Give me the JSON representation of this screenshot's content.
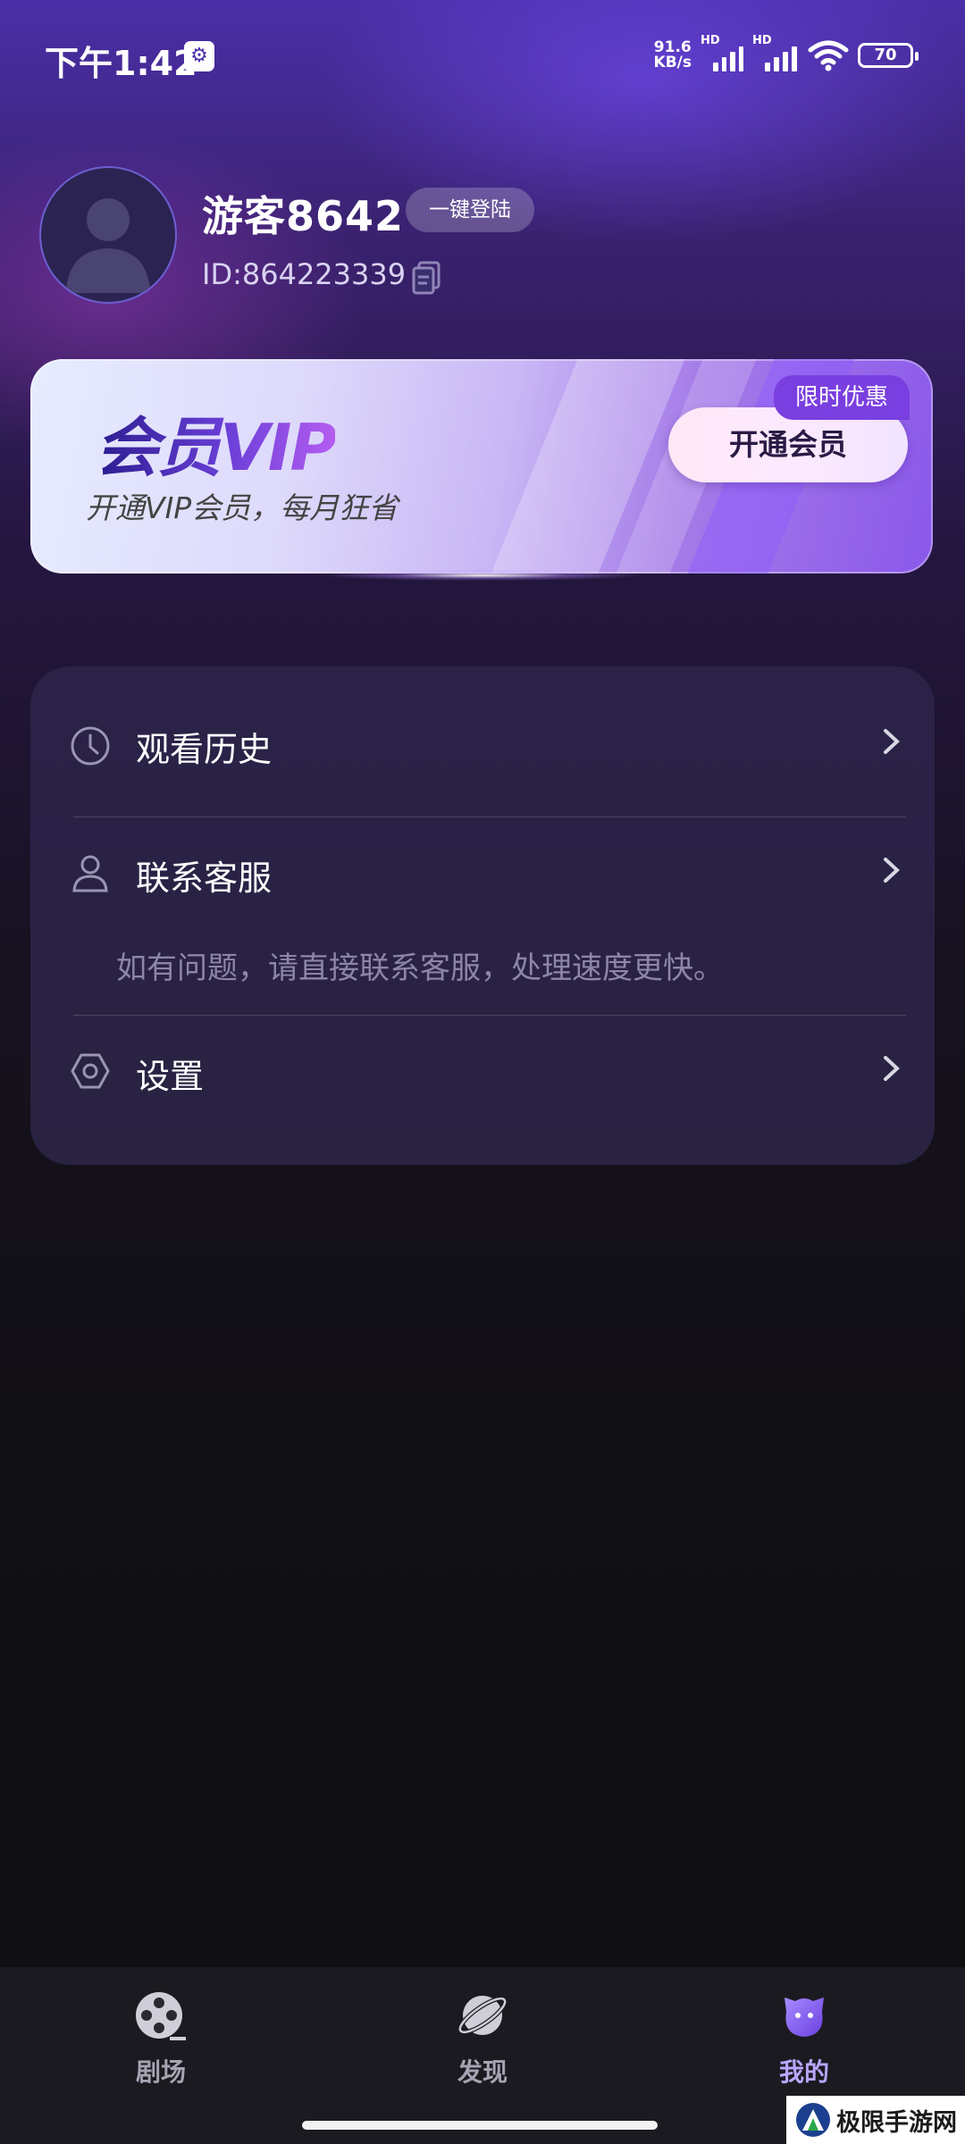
{
  "status_bar": {
    "time": "下午1:42",
    "net_speed_value": "91.6",
    "net_speed_unit": "KB/s",
    "hd_1": "HD",
    "hd_2": "HD",
    "battery": "70"
  },
  "profile": {
    "username": "游客8642",
    "login_button": "一键登陆",
    "user_id": "ID:864223339"
  },
  "vip_card": {
    "title": "会员VIP",
    "subtitle": "开通VIP会员，每月狂省",
    "button": "开通会员",
    "badge": "限时优惠"
  },
  "menu": {
    "items": [
      {
        "label": "观看历史",
        "icon": "clock-icon"
      },
      {
        "label": "联系客服",
        "icon": "person-icon",
        "description": "如有问题，请直接联系客服，处理速度更快。"
      },
      {
        "label": "设置",
        "icon": "hexagon-gear-icon"
      }
    ]
  },
  "bottom_nav": {
    "items": [
      {
        "label": "剧场",
        "icon": "film-reel-icon",
        "active": false
      },
      {
        "label": "发现",
        "icon": "planet-icon",
        "active": false
      },
      {
        "label": "我的",
        "icon": "mascot-face-icon",
        "active": true
      }
    ]
  },
  "watermark": {
    "text": "极限手游网"
  },
  "colors": {
    "accent": "#b8a6ff",
    "vip_badge": "#7a3fe0",
    "menu_card": "#2a2244"
  }
}
